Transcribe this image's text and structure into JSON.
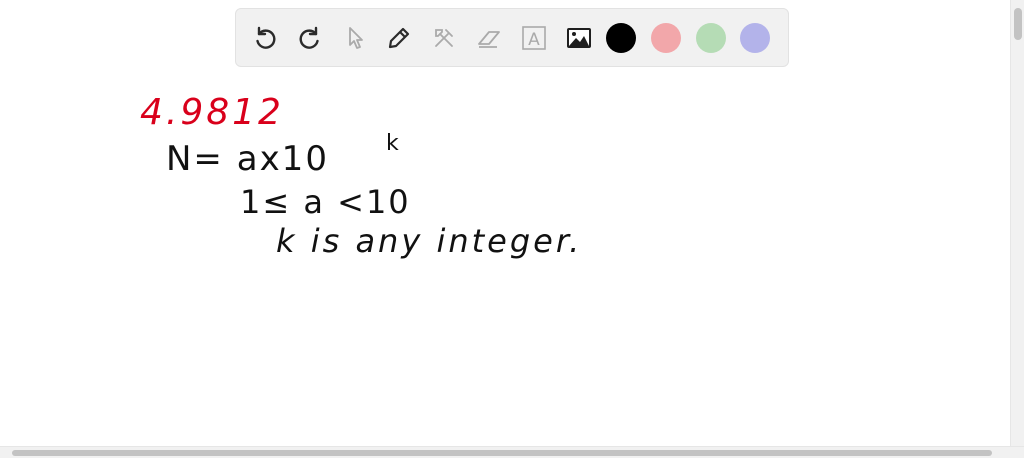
{
  "toolbar": {
    "tools": [
      {
        "name": "undo-icon"
      },
      {
        "name": "redo-icon"
      },
      {
        "name": "select-arrow-icon"
      },
      {
        "name": "pencil-icon"
      },
      {
        "name": "tools-icon"
      },
      {
        "name": "eraser-icon"
      },
      {
        "name": "text-box-icon",
        "glyph": "A"
      },
      {
        "name": "image-icon"
      }
    ],
    "colors": [
      "#000000",
      "#f2a7aa",
      "#b5dcb5",
      "#b3b3ea"
    ]
  },
  "canvas": {
    "ink_colors": {
      "red": "#d9001b",
      "black": "#111111"
    },
    "lines": [
      {
        "text": "4.9812"
      },
      {
        "text": "N= ax10",
        "superscript": "k"
      },
      {
        "text": "1≤ a <10"
      },
      {
        "text": "k is any integer."
      }
    ]
  }
}
